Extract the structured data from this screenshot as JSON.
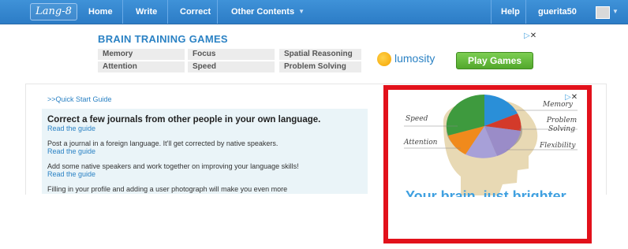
{
  "nav": {
    "logo_text": "Lang-8",
    "items": [
      {
        "label": "Home"
      },
      {
        "label": "Write"
      },
      {
        "label": "Correct"
      },
      {
        "label": "Other Contents"
      }
    ],
    "help_label": "Help",
    "username": "guerita50"
  },
  "top_ad": {
    "title": "BRAIN TRAINING GAMES",
    "skills": [
      "Memory",
      "Focus",
      "Spatial Reasoning",
      "Attention",
      "Speed",
      "Problem Solving"
    ],
    "brand": "lumosity",
    "button_label": "Play Games"
  },
  "main": {
    "quick_start_label": ">>Quick Start Guide",
    "headline": "Correct a few journals from other people in your own language.",
    "read_guide_label": "Read the guide",
    "lines": [
      "Post a journal in a foreign language. It'll get corrected by native speakers.",
      "Add some native speakers and work together on improving your language skills!",
      "Filling in your profile and adding a user photograph will make you even more"
    ]
  },
  "side_ad": {
    "labels": [
      "Memory",
      "Speed",
      "Problem Solving",
      "Attention",
      "Flexibility"
    ],
    "tagline": "Your brain, just brighter",
    "highlight_color": "#e2111b"
  },
  "colors": {
    "nav_blue": "#2c7cc6",
    "link_blue": "#2b82c4",
    "button_green": "#5cb531",
    "highlight_red": "#e2111b"
  }
}
